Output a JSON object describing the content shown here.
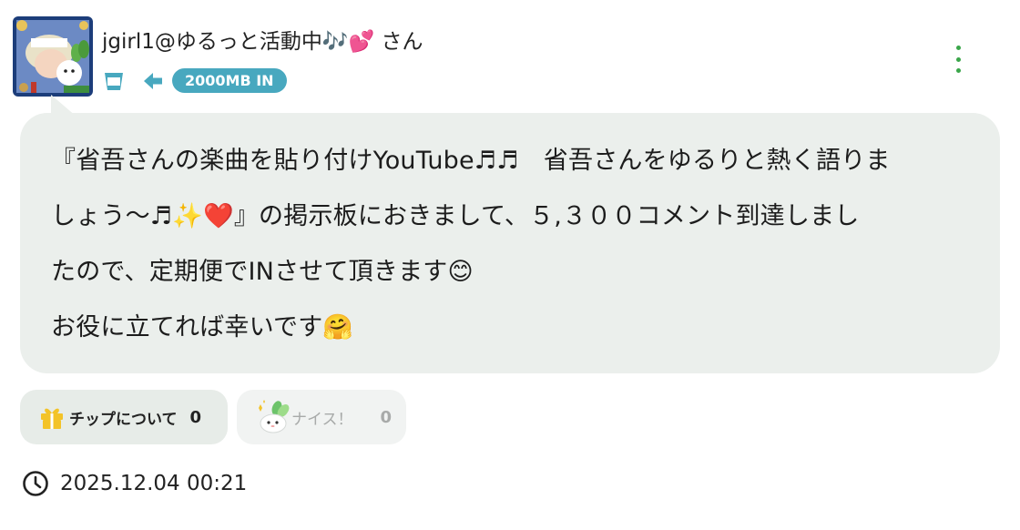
{
  "user": {
    "name": "jgirl1@ゆるっと活動中🎶💕 さん",
    "avatar": "avatar-image",
    "badge_text": "2000MB IN",
    "icons": [
      "cup-icon",
      "arrow-left-icon"
    ]
  },
  "menu": {
    "icon": "more-vertical-icon"
  },
  "post": {
    "lines": [
      "『省吾さんの楽曲を貼り付けYouTube♬♬　省吾さんをゆるりと熱く語りま",
      "しょう〜♬✨❤️』の掲示板におきまして、５,３００コメント到達しまし",
      "たので、定期便でINさせて頂きます😊",
      "お役に立てれば幸いです🤗"
    ]
  },
  "actions": {
    "tip": {
      "label": "チップについて",
      "count": "0",
      "icon": "gift-icon"
    },
    "nice": {
      "label": "ナイス！",
      "count": "0",
      "icon": "nice-icon"
    }
  },
  "timestamp": {
    "icon": "clock-icon",
    "text": "2025.12.04 00:21"
  },
  "colors": {
    "badge": "#48a8bf",
    "bubble": "#ebefec",
    "menu_dots": "#3aa64a",
    "tip_button": "#e7ece8",
    "nice_button": "#f1f3f2",
    "gift": "#f3c328"
  }
}
